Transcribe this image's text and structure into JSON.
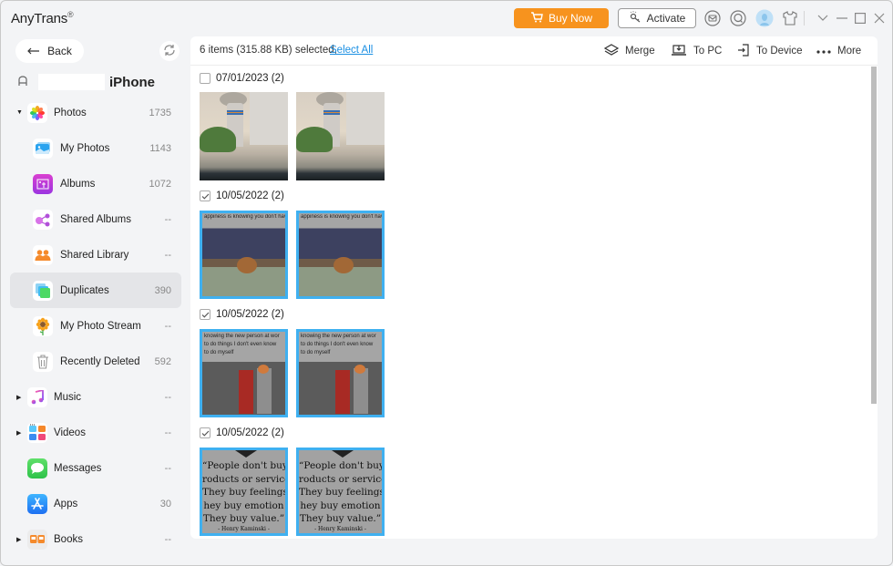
{
  "app": {
    "title": "AnyTrans",
    "trademark": "®",
    "buy_now_label": "Buy Now",
    "activate_label": "Activate",
    "accent_color": "#f7931e",
    "link_color": "#1a8fe3",
    "selection_color": "#3fb0f0"
  },
  "window_controls": {
    "menu": "⌄",
    "minimize": "–",
    "maximize": "☐",
    "close": "✕"
  },
  "sidebar": {
    "back_label": "Back",
    "device": {
      "name": "iPhone"
    },
    "items": [
      {
        "label": "Photos",
        "count": "1735",
        "level": 0,
        "expanded": true,
        "icon": "photos-icon"
      },
      {
        "label": "My Photos",
        "count": "1143",
        "level": 1,
        "icon": "my-photos-icon"
      },
      {
        "label": "Albums",
        "count": "1072",
        "level": 1,
        "icon": "albums-icon"
      },
      {
        "label": "Shared Albums",
        "count": "--",
        "level": 1,
        "icon": "shared-albums-icon"
      },
      {
        "label": "Shared Library",
        "count": "--",
        "level": 1,
        "icon": "shared-library-icon"
      },
      {
        "label": "Duplicates",
        "count": "390",
        "level": 1,
        "active": true,
        "icon": "duplicates-icon"
      },
      {
        "label": "My Photo Stream",
        "count": "--",
        "level": 1,
        "icon": "photo-stream-icon"
      },
      {
        "label": "Recently Deleted",
        "count": "592",
        "level": 1,
        "icon": "trash-icon"
      },
      {
        "label": "Music",
        "count": "--",
        "level": 0,
        "expandable": true,
        "icon": "music-icon"
      },
      {
        "label": "Videos",
        "count": "--",
        "level": 0,
        "expandable": true,
        "icon": "videos-icon"
      },
      {
        "label": "Messages",
        "count": "--",
        "level": 0,
        "icon": "messages-icon"
      },
      {
        "label": "Apps",
        "count": "30",
        "level": 0,
        "icon": "apps-icon"
      },
      {
        "label": "Books",
        "count": "--",
        "level": 0,
        "expandable": true,
        "icon": "books-icon"
      }
    ]
  },
  "toolbar": {
    "selection_text": "6 items (315.88 KB) selected,",
    "select_all_label": "Select All",
    "merge_label": "Merge",
    "to_pc_label": "To PC",
    "to_device_label": "To Device",
    "more_label": "More"
  },
  "groups": [
    {
      "label": "07/01/2023 (2)",
      "checked": false,
      "photos": [
        {
          "kind": "power-plant",
          "selected": false
        },
        {
          "kind": "power-plant",
          "selected": false
        }
      ]
    },
    {
      "label": "10/05/2022 (2)",
      "checked": true,
      "photos": [
        {
          "kind": "meme-jerry",
          "selected": true,
          "caption": "appiness is knowing you don't hav set an alarm for the next day..."
        },
        {
          "kind": "meme-jerry",
          "selected": true,
          "caption": "appiness is knowing you don't hav set an alarm for the next day..."
        }
      ]
    },
    {
      "label": "10/05/2022 (2)",
      "checked": true,
      "photos": [
        {
          "kind": "meme-joker",
          "selected": true,
          "caption": [
            "knowing the new person at wor",
            "to do things I don't even know",
            "to do myself"
          ]
        },
        {
          "kind": "meme-joker",
          "selected": true,
          "caption": [
            "knowing the new person at wor",
            "to do things I don't even know",
            "to do myself"
          ]
        }
      ]
    },
    {
      "label": "10/05/2022 (2)",
      "checked": true,
      "photos": [
        {
          "kind": "quote",
          "selected": true,
          "lines": [
            "“People don't buy",
            "roducts or service",
            "They buy feelings",
            "hey buy emotion",
            "They buy value.”"
          ],
          "author": "- Henry Kaminski -"
        },
        {
          "kind": "quote",
          "selected": true,
          "lines": [
            "“People don't buy",
            "roducts or service",
            "They buy feelings",
            "hey buy emotion",
            "They buy value.”"
          ],
          "author": "- Henry Kaminski -"
        }
      ]
    }
  ]
}
